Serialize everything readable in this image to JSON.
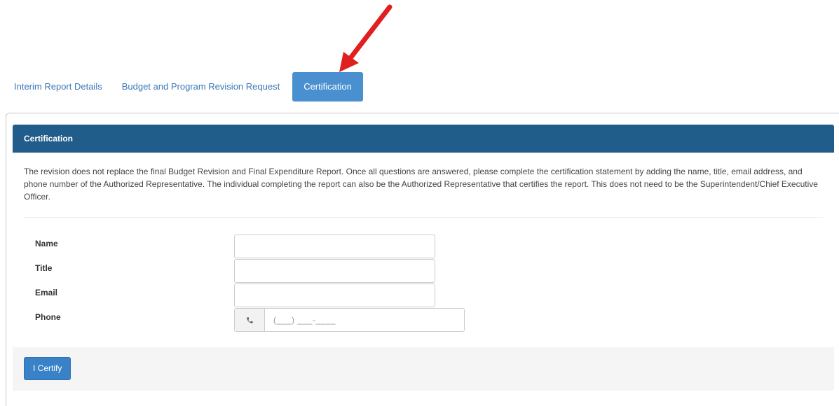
{
  "tabs": [
    {
      "label": "Interim Report Details",
      "active": false
    },
    {
      "label": "Budget and Program Revision Request",
      "active": false
    },
    {
      "label": "Certification",
      "active": true
    }
  ],
  "card": {
    "header_title": "Certification",
    "description": "The revision does not replace the final Budget Revision and Final Expenditure Report. Once all questions are answered, please complete the certification statement by adding the name, title, email address, and phone number of the Authorized Representative. The individual completing the report can also be the Authorized Representative that certifies the report. This does not need to be the Superintendent/Chief Executive Officer."
  },
  "form": {
    "name_label": "Name",
    "name_value": "",
    "title_label": "Title",
    "title_value": "",
    "email_label": "Email",
    "email_value": "",
    "phone_label": "Phone",
    "phone_placeholder": "(___) ___-____",
    "phone_icon": "phone-icon"
  },
  "footer": {
    "certify_label": "I Certify"
  },
  "colors": {
    "header_bg": "#215d8a",
    "active_tab_bg": "#4a90d0",
    "button_bg": "#3a82c8",
    "arrow": "#e02020"
  }
}
